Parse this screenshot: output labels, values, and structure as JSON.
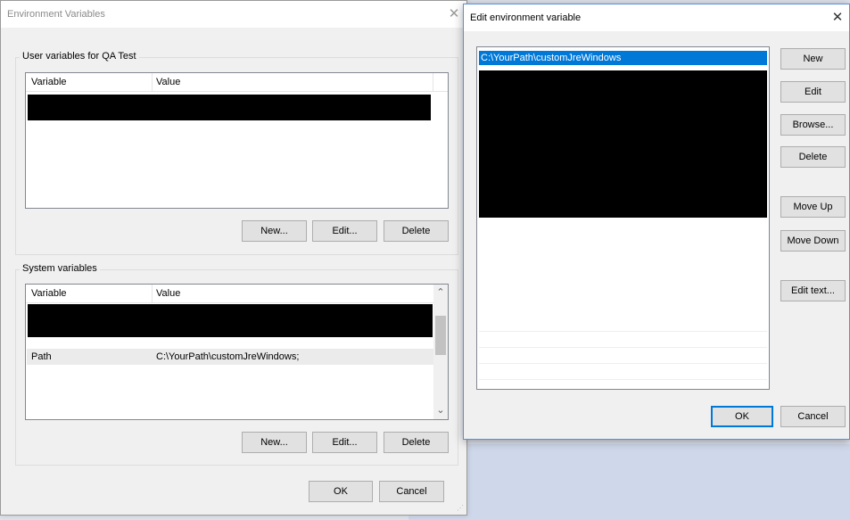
{
  "env_dialog": {
    "title": "Environment Variables",
    "user_group_label": "User variables for QA Test",
    "user_list": {
      "columns": [
        "Variable",
        "Value"
      ],
      "rows": [
        {
          "variable": "",
          "value": "",
          "redacted": true
        }
      ]
    },
    "user_buttons": {
      "new": "New...",
      "edit": "Edit...",
      "delete": "Delete"
    },
    "system_group_label": "System variables",
    "system_list": {
      "columns": [
        "Variable",
        "Value"
      ],
      "rows": [
        {
          "variable": "",
          "value": "",
          "redacted": true
        },
        {
          "variable": "Path",
          "value": "C:\\YourPath\\customJreWindows;",
          "selected": true
        }
      ]
    },
    "system_buttons": {
      "new": "New...",
      "edit": "Edit...",
      "delete": "Delete"
    },
    "footer": {
      "ok": "OK",
      "cancel": "Cancel"
    }
  },
  "edit_dialog": {
    "title": "Edit environment variable",
    "entries": [
      {
        "text": "C:\\YourPath\\customJreWindows",
        "selected": true
      },
      {
        "text": "",
        "redacted": true
      }
    ],
    "buttons": {
      "new": "New",
      "edit": "Edit",
      "browse": "Browse...",
      "delete": "Delete",
      "move_up": "Move Up",
      "move_down": "Move Down",
      "edit_text": "Edit text..."
    },
    "footer": {
      "ok": "OK",
      "cancel": "Cancel"
    }
  },
  "icons": {
    "close": "close-icon",
    "scroll_up": "chevron-up-icon",
    "scroll_down": "chevron-down-icon"
  },
  "colors": {
    "accent": "#0078d7",
    "redaction": "#000000",
    "dialog_bg": "#f0f0f0"
  }
}
